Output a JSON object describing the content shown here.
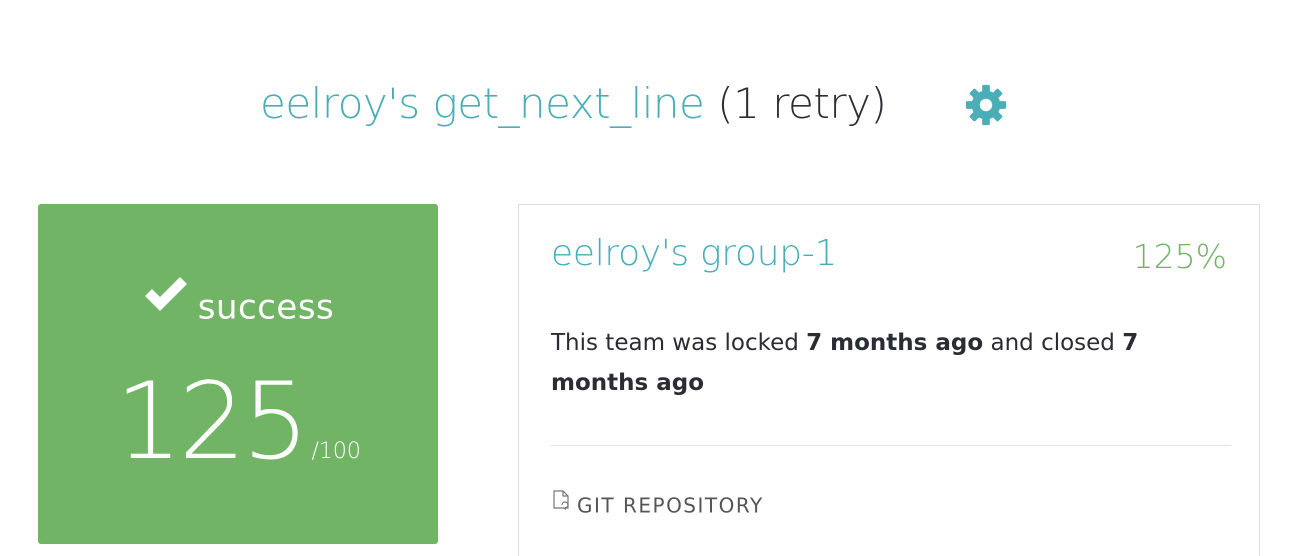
{
  "header": {
    "project_title": "eelroy's get_next_line",
    "retry_text": " (1 retry)",
    "settings_icon": "gear-icon"
  },
  "score": {
    "status_icon": "check-icon",
    "status": "success",
    "value": "125",
    "max": "/100"
  },
  "team": {
    "name": "eelroy's group-1",
    "percent": "125%",
    "status_prefix": "This team was locked ",
    "locked_ago": "7 months ago",
    "status_middle": " and closed ",
    "closed_ago": "7 months ago",
    "repo_icon": "git-repository-icon",
    "repo_label": "GIT REPOSITORY"
  },
  "colors": {
    "accent_teal": "#4aaeb7",
    "success_green": "#72b466",
    "text_dark": "#2c2c34"
  }
}
